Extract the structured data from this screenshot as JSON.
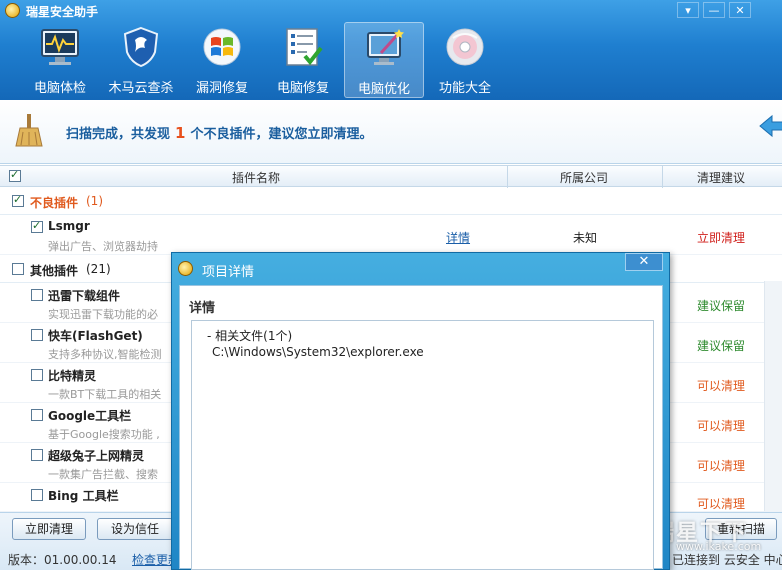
{
  "app": {
    "title": "瑞星安全助手",
    "window_buttons": [
      "▾",
      "—",
      "✕"
    ]
  },
  "toolbar": {
    "items": [
      {
        "label": "电脑体检",
        "icon": "monitor-checkup-icon"
      },
      {
        "label": "木马云查杀",
        "icon": "shield-icon"
      },
      {
        "label": "漏洞修复",
        "icon": "windows-logo-icon"
      },
      {
        "label": "电脑修复",
        "icon": "checklist-icon"
      },
      {
        "label": "电脑优化",
        "icon": "magic-wand-monitor-icon",
        "active": true
      },
      {
        "label": "功能大全",
        "icon": "disc-icon"
      }
    ]
  },
  "banner": {
    "prefix": "扫描完成，共发现",
    "count": "1",
    "suffix": "个不良插件，建议您立即清理。"
  },
  "table": {
    "headers": [
      "插件名称",
      "所属公司",
      "清理建议"
    ],
    "groups": [
      {
        "name": "不良插件",
        "count": "(1)",
        "checked": true
      },
      {
        "name": "其他插件",
        "count": "(21)",
        "checked": false
      }
    ],
    "bad_rows": [
      {
        "name": "Lsmgr",
        "desc": "弹出广告、浏览器劫持",
        "detail": "详情",
        "company": "未知",
        "advice": "立即清理",
        "checked": true
      }
    ],
    "other_rows": [
      {
        "name": "迅雷下载组件",
        "desc": "实现迅雷下载功能的必",
        "advice": "建议保留"
      },
      {
        "name": "快车(FlashGet)",
        "desc": "支持多种协议,智能检测",
        "advice": "建议保留"
      },
      {
        "name": "比特精灵",
        "desc": "一款BT下载工具的相关",
        "advice": "可以清理"
      },
      {
        "name": "Google工具栏",
        "desc": "基于Google搜索功能 ,",
        "advice": "可以清理"
      },
      {
        "name": "超级兔子上网精灵",
        "desc": "一款集广告拦截、搜索",
        "advice": "可以清理"
      },
      {
        "name": "Bing 工具栏",
        "desc": "",
        "advice": "可以清理"
      }
    ]
  },
  "colors": {
    "advice_keep": "#2e8b2e",
    "advice_clean": "#e05a1e",
    "advice_now": "#d0201c"
  },
  "footer": {
    "clean_button": "立即清理",
    "trust_button": "设为信任",
    "rescan_button": "重新扫描",
    "version": "版本：01.00.00.14",
    "update_link": "检查更新",
    "cloud_status": "已连接到 云安全 中心",
    "watermark": "瑞星下下",
    "watermark_url": "www.ikake.com"
  },
  "dialog": {
    "title": "项目详情",
    "close": "✕",
    "heading": "详情",
    "line1": "- 相关文件(1个)",
    "line2": "C:\\Windows\\System32\\explorer.exe"
  }
}
